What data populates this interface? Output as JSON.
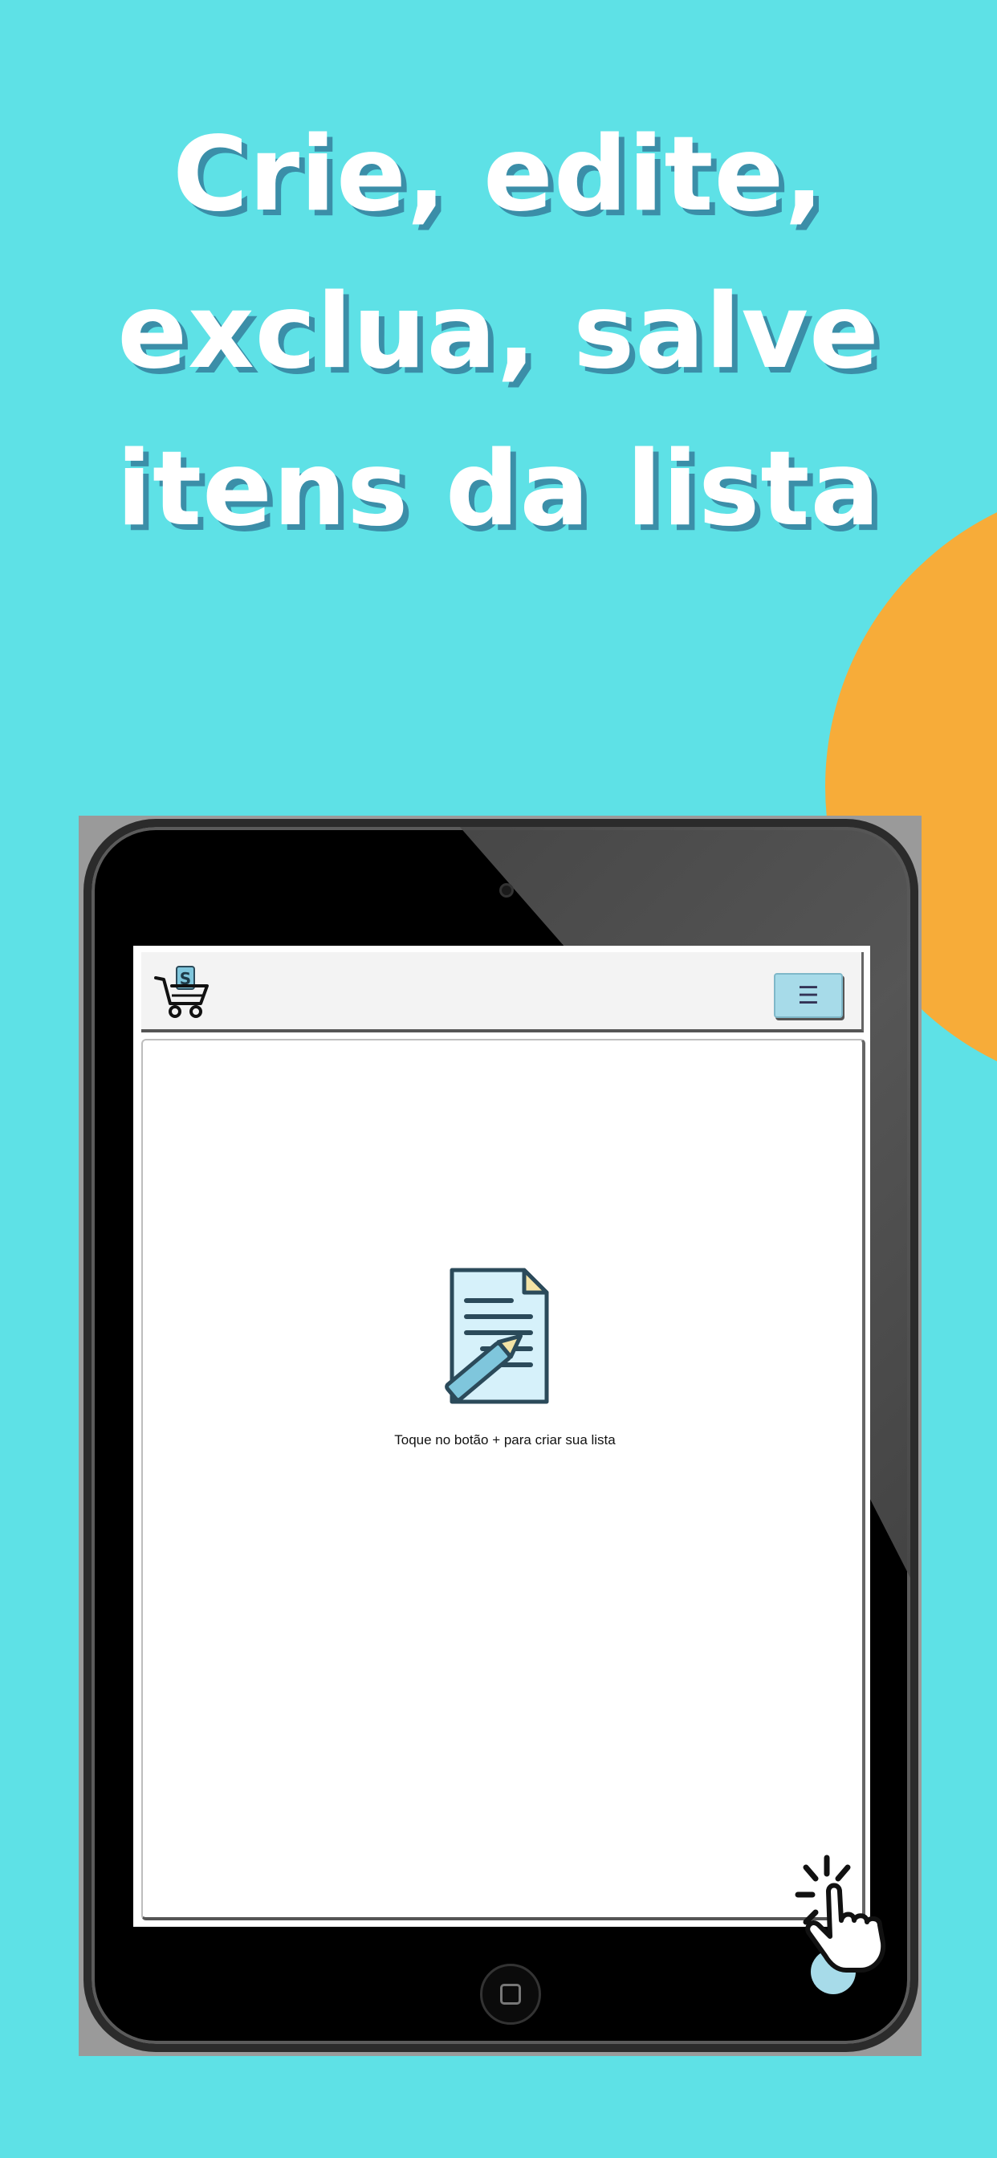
{
  "headline": {
    "line1": "Crie, edite,",
    "line2": "exclua, salve",
    "line3": "itens da lista"
  },
  "app": {
    "menu_icon": "☰",
    "empty_message": "Toque no botão + para criar sua lista"
  },
  "colors": {
    "background": "#5ee1e6",
    "accent_orange": "#f7ac39",
    "button_blue": "#a7dbe9"
  },
  "icons": [
    "shopping-cart-logo-icon",
    "hamburger-menu-icon",
    "document-pencil-icon",
    "tap-hand-icon"
  ]
}
